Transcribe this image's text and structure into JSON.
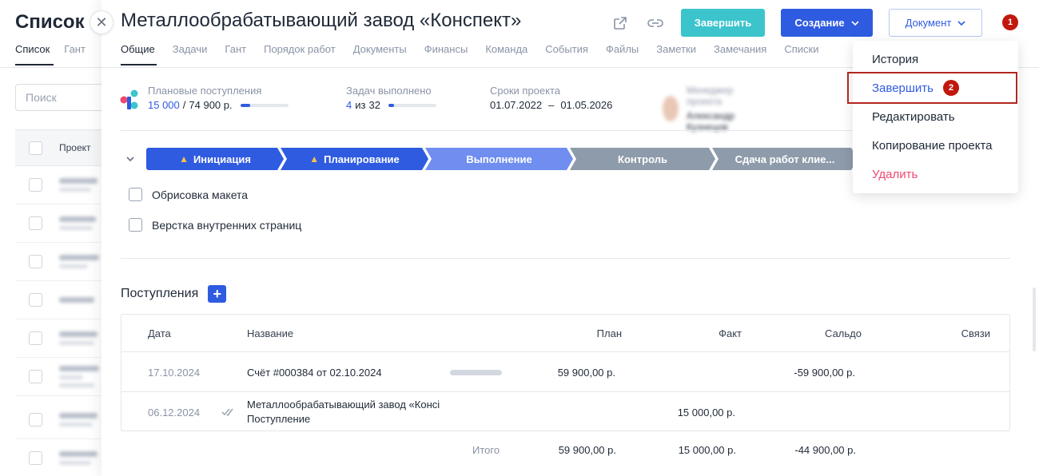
{
  "background": {
    "title": "Список",
    "tabs": [
      "Список",
      "Гант"
    ],
    "search_placeholder": "Поиск",
    "column_project": "Проект"
  },
  "header": {
    "title": "Металлообрабатывающий завод «Конспект»",
    "finish_label": "Завершить",
    "create_label": "Создание",
    "document_label": "Документ",
    "badge_1": "1"
  },
  "tabs": [
    "Общие",
    "Задачи",
    "Гант",
    "Порядок работ",
    "Документы",
    "Финансы",
    "Команда",
    "События",
    "Файлы",
    "Заметки",
    "Замечания",
    "Списки"
  ],
  "stats": {
    "planned_label": "Плановые поступления",
    "planned_value": "15 000",
    "planned_total": "74 900 р.",
    "planned_progress": 0.2,
    "tasks_label": "Задач выполнено",
    "tasks_done": "4",
    "tasks_of": "из",
    "tasks_total": "32",
    "tasks_progress": 0.125,
    "deadline_label": "Сроки проекта",
    "deadline_start": "01.07.2022",
    "deadline_sep": "–",
    "deadline_end": "01.05.2026",
    "manager_label": "Менеджер проекта",
    "manager_name": "Александр Кузнецов"
  },
  "pipeline": [
    {
      "label": "Инициация",
      "warning": true,
      "color": "#2f5be1"
    },
    {
      "label": "Планирование",
      "warning": true,
      "color": "#2f5be1"
    },
    {
      "label": "Выполнение",
      "warning": false,
      "color": "#6f8ef0"
    },
    {
      "label": "Контроль",
      "warning": false,
      "color": "#8e9bab"
    },
    {
      "label": "Сдача работ клие...",
      "warning": false,
      "color": "#8e9bab"
    }
  ],
  "tasks": [
    "Обрисовка макета",
    "Верстка внутренних страниц"
  ],
  "income": {
    "title": "Поступления",
    "columns": {
      "date": "Дата",
      "name": "Название",
      "plan": "План",
      "fact": "Факт",
      "balance": "Сальдо",
      "links": "Связи"
    },
    "rows": [
      {
        "date": "17.10.2024",
        "name": "Счёт #000384 от 02.10.2024",
        "sub": "",
        "plan": "59 900,00 р.",
        "fact": "",
        "balance": "-59 900,00 р."
      },
      {
        "date": "06.12.2024",
        "name": "Металлообрабатывающий завод «Консі",
        "sub": "Поступление",
        "plan": "",
        "fact": "15 000,00 р.",
        "balance": ""
      }
    ],
    "totals": {
      "label": "Итого",
      "plan": "59 900,00 р.",
      "fact": "15 000,00 р.",
      "balance": "-44 900,00 р."
    }
  },
  "dropdown": {
    "items": [
      "История",
      "Завершить",
      "Редактировать",
      "Копирование проекта",
      "Удалить"
    ],
    "badge_2": "2"
  },
  "colors": {
    "accent": "#2f5be1",
    "teal": "#3cc4cd",
    "danger": "#ef476f",
    "marker": "#c0180e"
  }
}
